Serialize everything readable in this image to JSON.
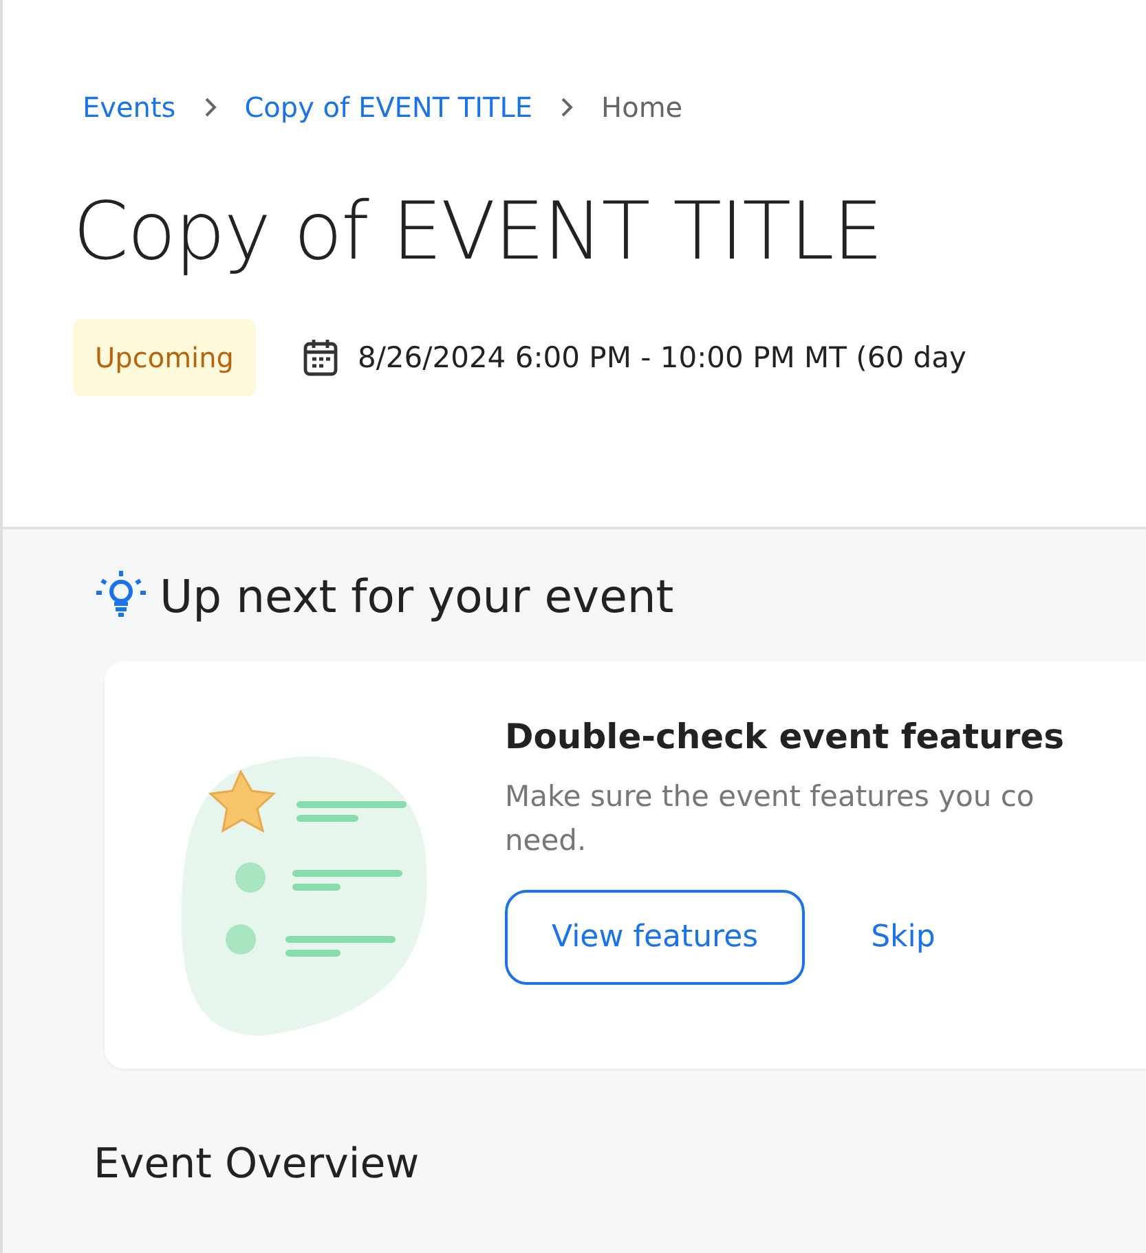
{
  "breadcrumb": [
    {
      "label": "Events",
      "kind": "link"
    },
    {
      "label": "Copy of EVENT TITLE",
      "kind": "link"
    },
    {
      "label": "Home",
      "kind": "current"
    }
  ],
  "title": "Copy of EVENT TITLE",
  "status_badge": "Upcoming",
  "date_range": "8/26/2024 6:00 PM - 10:00 PM MT (60 day",
  "up_next": {
    "heading": "Up next for your event",
    "card": {
      "title": "Double-check event features",
      "description_lines": [
        "Make sure the event features you co",
        "need."
      ],
      "buttons": [
        {
          "label": "View features",
          "kind": "outline"
        },
        {
          "label": "Skip",
          "kind": "text"
        }
      ]
    }
  },
  "section_heading": "Event Overview"
}
